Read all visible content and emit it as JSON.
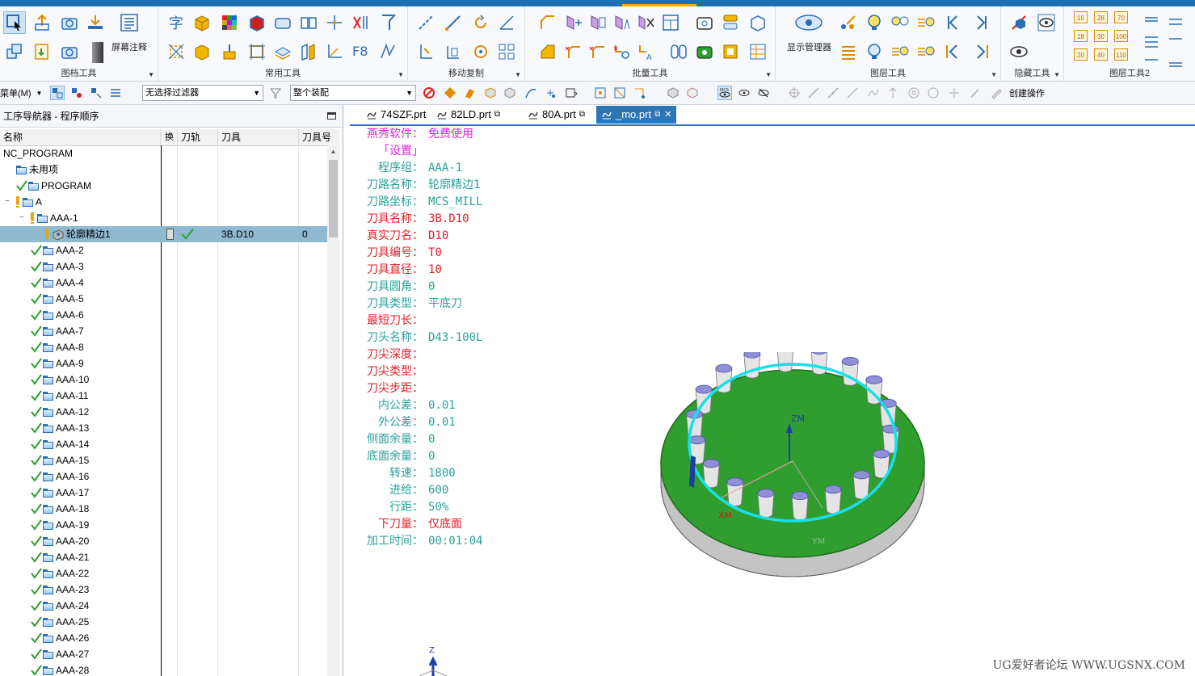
{
  "ribbon": {
    "groups": [
      {
        "label": "图档工具"
      },
      {
        "label": "常用工具"
      },
      {
        "label": "移动复制"
      },
      {
        "label": "批量工具"
      },
      {
        "label": "图层工具"
      },
      {
        "label": "隐藏工具"
      },
      {
        "label": "图层工具2"
      }
    ],
    "screen_annot_label": "屏幕注释",
    "display_manager_label": "显示管理器",
    "f8_label": "F8",
    "num_grid": [
      "10",
      "28",
      "70",
      "18",
      "30",
      "100",
      "20",
      "40",
      "110"
    ]
  },
  "toolbar2": {
    "menu_label": "菜单(M)",
    "filter_value": "无选择过滤器",
    "assembly_value": "整个装配",
    "create_op_label": "创建操作"
  },
  "navigator": {
    "title": "工序导航器 - 程序顺序",
    "columns": [
      "名称",
      "换",
      "刀轨",
      "刀具",
      "刀具号"
    ],
    "rows": [
      {
        "name": "NC_PROGRAM",
        "level": 0,
        "icon": "none",
        "status": "none"
      },
      {
        "name": "未用项",
        "level": 1,
        "icon": "folder",
        "status": "none"
      },
      {
        "name": "PROGRAM",
        "level": 1,
        "icon": "folder",
        "status": "check"
      },
      {
        "name": "A",
        "level": 1,
        "icon": "folder",
        "status": "warn",
        "toggle": "−"
      },
      {
        "name": "AAA-1",
        "level": 2,
        "icon": "folder",
        "status": "warn",
        "toggle": "−"
      },
      {
        "name": "轮廓精边1",
        "level": 3,
        "icon": "operation",
        "status": "warn",
        "selected": true,
        "tool": "3B.D10",
        "tool_no": "0"
      },
      {
        "name": "AAA-2",
        "level": 2,
        "icon": "folder",
        "status": "check"
      },
      {
        "name": "AAA-3",
        "level": 2,
        "icon": "folder",
        "status": "check"
      },
      {
        "name": "AAA-4",
        "level": 2,
        "icon": "folder",
        "status": "check"
      },
      {
        "name": "AAA-5",
        "level": 2,
        "icon": "folder",
        "status": "check"
      },
      {
        "name": "AAA-6",
        "level": 2,
        "icon": "folder",
        "status": "check"
      },
      {
        "name": "AAA-7",
        "level": 2,
        "icon": "folder",
        "status": "check"
      },
      {
        "name": "AAA-8",
        "level": 2,
        "icon": "folder",
        "status": "check"
      },
      {
        "name": "AAA-9",
        "level": 2,
        "icon": "folder",
        "status": "check"
      },
      {
        "name": "AAA-10",
        "level": 2,
        "icon": "folder",
        "status": "check"
      },
      {
        "name": "AAA-11",
        "level": 2,
        "icon": "folder",
        "status": "check"
      },
      {
        "name": "AAA-12",
        "level": 2,
        "icon": "folder",
        "status": "check"
      },
      {
        "name": "AAA-13",
        "level": 2,
        "icon": "folder",
        "status": "check"
      },
      {
        "name": "AAA-14",
        "level": 2,
        "icon": "folder",
        "status": "check"
      },
      {
        "name": "AAA-15",
        "level": 2,
        "icon": "folder",
        "status": "check"
      },
      {
        "name": "AAA-16",
        "level": 2,
        "icon": "folder",
        "status": "check"
      },
      {
        "name": "AAA-17",
        "level": 2,
        "icon": "folder",
        "status": "check"
      },
      {
        "name": "AAA-18",
        "level": 2,
        "icon": "folder",
        "status": "check"
      },
      {
        "name": "AAA-19",
        "level": 2,
        "icon": "folder",
        "status": "check"
      },
      {
        "name": "AAA-20",
        "level": 2,
        "icon": "folder",
        "status": "check"
      },
      {
        "name": "AAA-21",
        "level": 2,
        "icon": "folder",
        "status": "check"
      },
      {
        "name": "AAA-22",
        "level": 2,
        "icon": "folder",
        "status": "check"
      },
      {
        "name": "AAA-23",
        "level": 2,
        "icon": "folder",
        "status": "check"
      },
      {
        "name": "AAA-24",
        "level": 2,
        "icon": "folder",
        "status": "check"
      },
      {
        "name": "AAA-25",
        "level": 2,
        "icon": "folder",
        "status": "check"
      },
      {
        "name": "AAA-26",
        "level": 2,
        "icon": "folder",
        "status": "check"
      },
      {
        "name": "AAA-27",
        "level": 2,
        "icon": "folder",
        "status": "check"
      },
      {
        "name": "AAA-28",
        "level": 2,
        "icon": "folder",
        "status": "check"
      }
    ]
  },
  "tabs": [
    {
      "label": "74SZF.prt",
      "active": false
    },
    {
      "label": "82LD.prt",
      "active": false
    },
    {
      "label": "80A.prt",
      "active": false
    },
    {
      "label": "_mo.prt",
      "active": true
    }
  ],
  "info_panel": {
    "lines": [
      {
        "key": "燕秀软件：",
        "value": "免费使用",
        "color": "#e020e0"
      },
      {
        "key": "「设置」",
        "value": "",
        "color": "#e020e0"
      },
      {
        "key": "程序组：",
        "value": "AAA-1",
        "color": "#2aa198"
      },
      {
        "key": "刀路名称：",
        "value": "轮廓精边1",
        "color": "#2aa198"
      },
      {
        "key": "刀路坐标：",
        "value": "MCS_MILL",
        "color": "#2aa198"
      },
      {
        "key": "刀具名称：",
        "value": "3B.D10",
        "color": "#e0202a"
      },
      {
        "key": "真实刀名：",
        "value": "D10",
        "color": "#e0202a"
      },
      {
        "key": "刀具编号：",
        "value": "T0",
        "color": "#e0202a"
      },
      {
        "key": "刀具直径：",
        "value": "10",
        "color": "#e0202a"
      },
      {
        "key": "刀具圆角：",
        "value": "0",
        "color": "#2aa198"
      },
      {
        "key": "刀具类型：",
        "value": "平底刀",
        "color": "#2aa198"
      },
      {
        "key": "最短刀长：",
        "value": "",
        "color": "#e0202a"
      },
      {
        "key": "刀头名称：",
        "value": "D43-100L",
        "color": "#2aa198"
      },
      {
        "key": "刀尖深度：",
        "value": "",
        "color": "#e0202a"
      },
      {
        "key": "刀尖类型：",
        "value": "",
        "color": "#e0202a"
      },
      {
        "key": "刀尖步距：",
        "value": "",
        "color": "#e0202a"
      },
      {
        "key": "内公差：",
        "value": "0.01",
        "color": "#2aa198"
      },
      {
        "key": "外公差：",
        "value": "0.01",
        "color": "#2aa198"
      },
      {
        "key": "侧面余量：",
        "value": "0",
        "color": "#2aa198"
      },
      {
        "key": "底面余量：",
        "value": "0",
        "color": "#2aa198"
      },
      {
        "key": "转速：",
        "value": "1800",
        "color": "#2aa198"
      },
      {
        "key": "进给：",
        "value": "600",
        "color": "#2aa198"
      },
      {
        "key": "行距：",
        "value": "50%",
        "color": "#2aa198"
      },
      {
        "key": "下刀量：",
        "value": "仅底面",
        "color": "#e0202a"
      },
      {
        "key": "加工时间：",
        "value": "00:01:04",
        "color": "#2aa198"
      }
    ]
  },
  "viewport": {
    "axis_zm": "ZM",
    "axis_xm": "XM",
    "axis_ym": "YM",
    "triad_z": "Z",
    "watermark": "UG爱好者论坛 WWW.UGSNX.COM"
  },
  "colors": {
    "accent": "#2e75b6",
    "plate_green": "#2f9e2f",
    "boss_blue": "#8f8fd8",
    "toolpath_cyan": "#19e0e8"
  }
}
